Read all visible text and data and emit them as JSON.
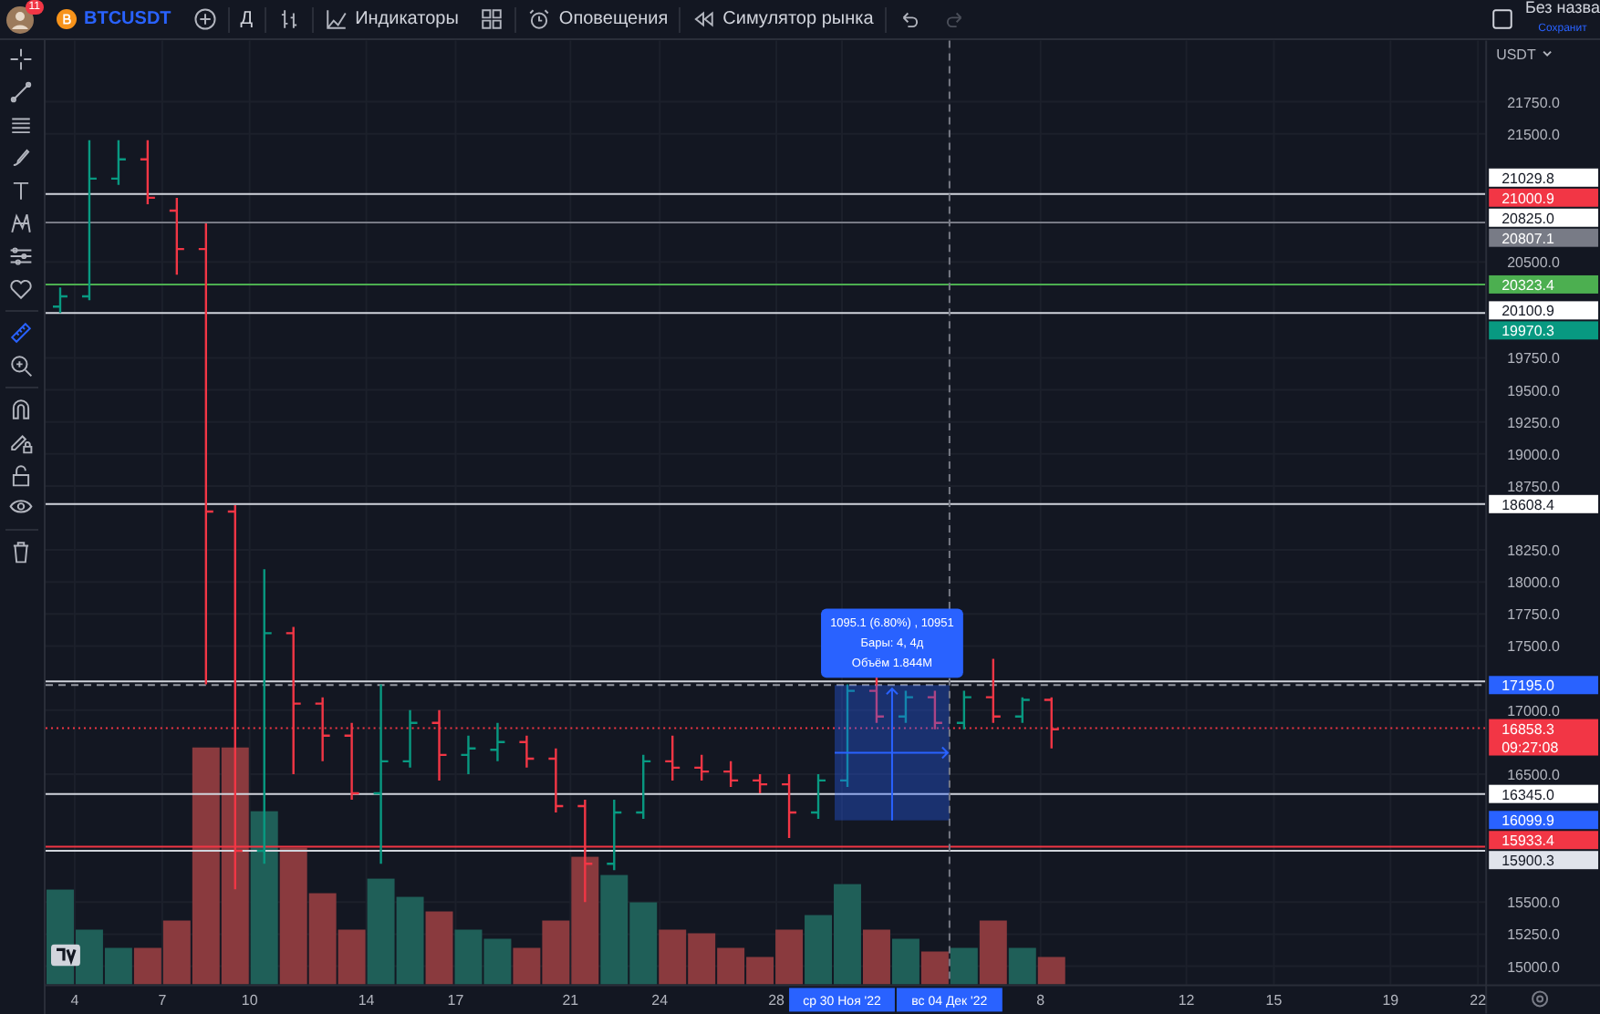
{
  "topbar": {
    "items": [
      {
        "kind": "avatar",
        "badge": "11"
      },
      {
        "kind": "symbol",
        "label": "BTCUSDT"
      },
      {
        "kind": "add"
      },
      {
        "kind": "interval",
        "label": "Д"
      },
      {
        "kind": "chart_type"
      },
      {
        "kind": "indicators",
        "label": "Индикаторы"
      },
      {
        "kind": "templates"
      },
      {
        "kind": "alerts",
        "label": "Оповещения"
      },
      {
        "kind": "replay",
        "label": "Симулятор рынка"
      },
      {
        "kind": "undo",
        "disabled": false
      },
      {
        "kind": "redo",
        "disabled": true
      }
    ],
    "layout": {
      "title": "Без назва",
      "subtitle": "Сохранит"
    }
  },
  "drawing_tools": [
    {
      "kind": "crosshair",
      "selected": false
    },
    {
      "kind": "trend_line",
      "selected": false
    },
    {
      "kind": "channel",
      "selected": false
    },
    {
      "kind": "brush",
      "selected": false
    },
    {
      "kind": "text",
      "selected": false
    },
    {
      "kind": "pattern",
      "selected": false
    },
    {
      "kind": "projection",
      "selected": false
    },
    {
      "kind": "favorite",
      "selected": false
    },
    {
      "kind": "measure",
      "selected": true
    },
    {
      "kind": "zoom",
      "selected": false
    },
    {
      "kind": "magnet",
      "selected": false
    },
    {
      "kind": "lock_drawing",
      "selected": false
    },
    {
      "kind": "lock",
      "selected": false
    },
    {
      "kind": "visibility",
      "selected": false
    },
    {
      "kind": "trash",
      "selected": false
    }
  ],
  "price_axis": {
    "currency": "USDT",
    "ticks": [
      "21750.0",
      "21500.0",
      "20500.0",
      "19750.0",
      "19500.0",
      "19250.0",
      "19000.0",
      "18750.0",
      "18250.0",
      "18000.0",
      "17750.0",
      "17500.0",
      "17000.0",
      "16500.0",
      "15500.0",
      "15250.0",
      "15000.0"
    ],
    "labels": [
      {
        "value": "21029.8",
        "color": "#ffffff",
        "kind": "solid"
      },
      {
        "value": "21000.9",
        "color": "#f23645",
        "kind": "plain"
      },
      {
        "value": "20825.0",
        "color": "#ffffff",
        "kind": "plain"
      },
      {
        "value": "20807.1",
        "color": "#787b86",
        "kind": "solid"
      },
      {
        "value": "20323.4",
        "color": "#4caf50",
        "kind": "solid"
      },
      {
        "value": "20100.9",
        "color": "#ffffff",
        "kind": "solid"
      },
      {
        "value": "19970.3",
        "color": "#089981",
        "kind": "plain"
      },
      {
        "value": "18608.4",
        "color": "#ffffff",
        "kind": "solid"
      },
      {
        "value": "17195.0",
        "color": "#2962ff",
        "kind": "dashed"
      },
      {
        "value": "16858.3",
        "sublabel": "09:27:08",
        "color": "#f23645",
        "kind": "dotted"
      },
      {
        "value": "16345.0",
        "color": "#ffffff",
        "kind": "solid"
      },
      {
        "value": "16099.9",
        "color": "#2962ff",
        "kind": "plain"
      },
      {
        "value": "15933.4",
        "color": "#f23645",
        "kind": "solid"
      },
      {
        "value": "15900.3",
        "color": "#e0e3eb",
        "kind": "solid"
      }
    ]
  },
  "time_axis": {
    "ticks": [
      {
        "label": "4",
        "highlighted": false
      },
      {
        "label": "7",
        "highlighted": false
      },
      {
        "label": "10",
        "highlighted": false
      },
      {
        "label": "14",
        "highlighted": false
      },
      {
        "label": "17",
        "highlighted": false
      },
      {
        "label": "21",
        "highlighted": false
      },
      {
        "label": "24",
        "highlighted": false
      },
      {
        "label": "28",
        "highlighted": false
      },
      {
        "label": "ср 30 Ноя '22",
        "highlighted": true
      },
      {
        "label": "вс 04 Дек '22",
        "highlighted": true
      },
      {
        "label": "8",
        "highlighted": false
      },
      {
        "label": "12",
        "highlighted": false
      },
      {
        "label": "15",
        "highlighted": false
      },
      {
        "label": "19",
        "highlighted": false
      },
      {
        "label": "22",
        "highlighted": false
      }
    ]
  },
  "measure": {
    "lines": [
      "1095.1 (6.80%) , 10951",
      "Бары: 4, 4д",
      "Объём 1.844M"
    ]
  }
}
